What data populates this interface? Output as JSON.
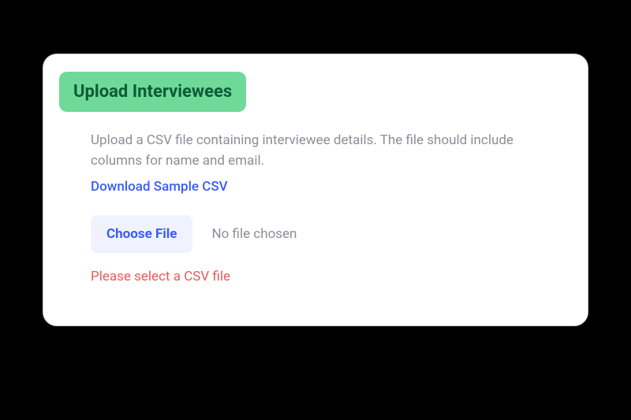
{
  "card": {
    "title": "Upload Interviewees",
    "description": "Upload a CSV file containing interviewee details. The file should include columns for name and email.",
    "download_link": "Download Sample CSV",
    "choose_file_label": "Choose File",
    "file_status": "No file chosen",
    "error_message": "Please select a CSV file"
  }
}
